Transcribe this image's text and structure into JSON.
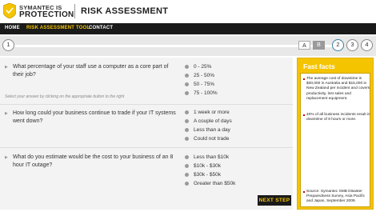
{
  "header": {
    "brand_line1": "SYMANTEC IS",
    "brand_line2": "PROTECTION",
    "title": "RISK ASSESSMENT",
    "logo_color": "#f5c400"
  },
  "nav": {
    "items": [
      "HOME",
      "RISK ASSESSMENT TOOL",
      "CONTACT"
    ],
    "active_index": 1,
    "active_color": "#f5c400"
  },
  "progress": {
    "steps": [
      "1",
      "2",
      "3",
      "4"
    ],
    "current_step": 1,
    "choices": [
      "A",
      "B"
    ]
  },
  "questions": [
    {
      "text": "What percentage of your staff use a computer as a core part of their job?",
      "options": [
        "0 - 25%",
        "25 - 50%",
        "50 - 75%",
        "75 - 100%"
      ]
    },
    {
      "text": "How long could your business continue to trade if your IT systems went down?",
      "options": [
        "1 week or more",
        "A couple of days",
        "Less than a day",
        "Could not trade"
      ]
    },
    {
      "text": "What do you estimate would be the cost to your business of an 8 hour IT outage?",
      "options": [
        "Less than $10k",
        "$10k - $30k",
        "$30k - $50k",
        "Greater than $50k"
      ]
    }
  ],
  "hint": "Select your answer by clicking on the appropriate button to the right",
  "next_button": "NEXT STEP",
  "facts": {
    "title": "Fast facts",
    "items": [
      "The average cost of downtime is $30,000 in Australia and $15,000 in New Zealand per incident and covers productivity, lost sales and replacement equipment.",
      "40% of all business incidents result in downtime of 8 hours or more.",
      "Source: Symantec SMB Disaster Preparedness Survey, Asia Pacific and Japan, September 2009."
    ]
  }
}
